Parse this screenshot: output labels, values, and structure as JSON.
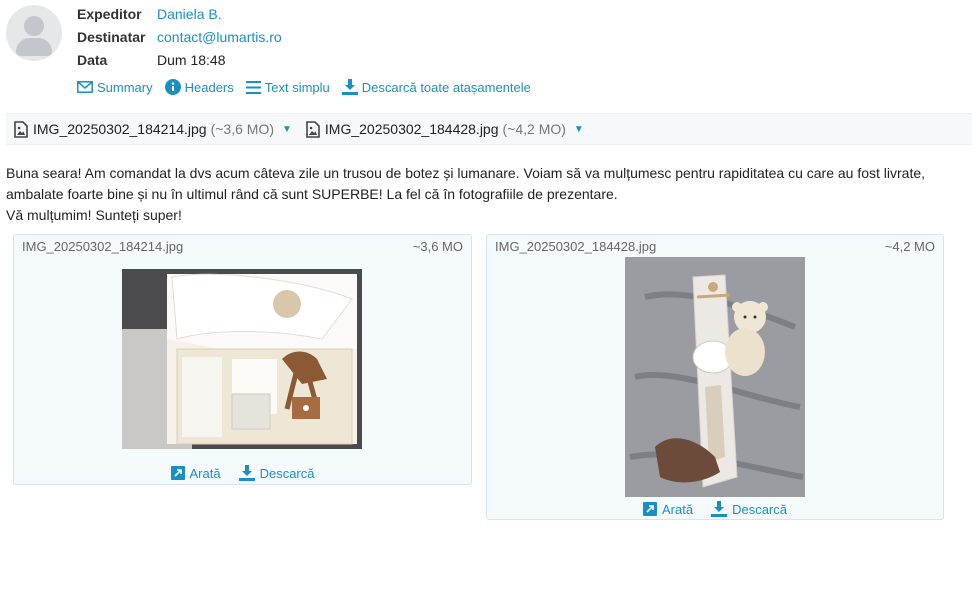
{
  "header": {
    "from_label": "Expeditor",
    "from_value": "Daniela B.",
    "to_label": "Destinatar",
    "to_value": "contact@lumartis.ro",
    "date_label": "Data",
    "date_value": "Dum 18:48"
  },
  "actions": {
    "summary": "Summary",
    "headers": "Headers",
    "plain_text": "Text simplu",
    "download_all": "Descarcă toate atașamentele"
  },
  "attachments": [
    {
      "name": "IMG_20250302_184214.jpg",
      "size": "(~3,6 MO)"
    },
    {
      "name": "IMG_20250302_184428.jpg",
      "size": "(~4,2 MO)"
    }
  ],
  "message": {
    "line1": "Buna seara! Am comandat la dvs acum câteva zile un trusou de botez și lumanare. Voiam să va mulțumesc pentru rapiditatea cu care au fost livrate,",
    "line2": "ambalate foarte bine și nu în ultimul rând că sunt SUPERBE! La fel că în fotografiile de prezentare.",
    "line3": "Vă mulțumim! Sunteți super!"
  },
  "cards": [
    {
      "name": "IMG_20250302_184214.jpg",
      "size": "~3,6 MO",
      "view": "Arată",
      "download": "Descarcă"
    },
    {
      "name": "IMG_20250302_184428.jpg",
      "size": "~4,2 MO",
      "view": "Arată",
      "download": "Descarcă"
    }
  ],
  "colors": {
    "accent": "#1a8fc4",
    "card_bg": "#f5fafd",
    "card_border": "#d6e4ee"
  }
}
